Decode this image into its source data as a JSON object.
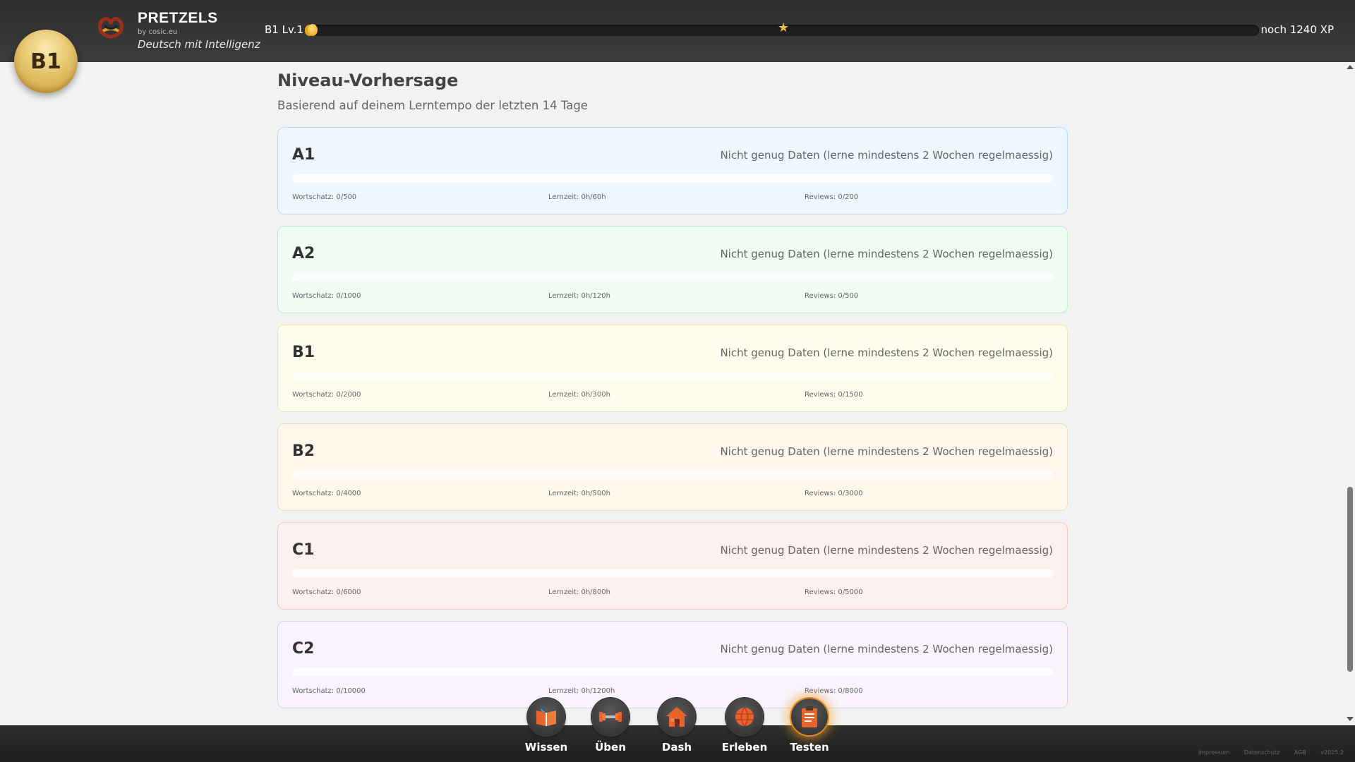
{
  "header": {
    "level_badge": "B1",
    "brand_name": "PRETZELS",
    "brand_by": "by cosic.eu",
    "tagline": "Deutsch mit Intelligenz",
    "level_label": "B1 Lv.1",
    "xp_progress": 0.01,
    "xp_remaining": "noch 1240 XP"
  },
  "main": {
    "title": "Niveau-Vorhersage",
    "subtitle": "Basierend auf deinem Lerntempo der letzten 14 Tage",
    "levels": [
      {
        "level": "A1",
        "message": "Nicht genug Daten (lerne mindestens 2 Wochen regelmaessig)",
        "progress": 0,
        "vocab": "Wortschatz: 0/500",
        "time": "Lernzeit: 0h/60h",
        "reviews": "Reviews: 0/200"
      },
      {
        "level": "A2",
        "message": "Nicht genug Daten (lerne mindestens 2 Wochen regelmaessig)",
        "progress": 0,
        "vocab": "Wortschatz: 0/1000",
        "time": "Lernzeit: 0h/120h",
        "reviews": "Reviews: 0/500"
      },
      {
        "level": "B1",
        "message": "Nicht genug Daten (lerne mindestens 2 Wochen regelmaessig)",
        "progress": 0,
        "vocab": "Wortschatz: 0/2000",
        "time": "Lernzeit: 0h/300h",
        "reviews": "Reviews: 0/1500"
      },
      {
        "level": "B2",
        "message": "Nicht genug Daten (lerne mindestens 2 Wochen regelmaessig)",
        "progress": 0,
        "vocab": "Wortschatz: 0/4000",
        "time": "Lernzeit: 0h/500h",
        "reviews": "Reviews: 0/3000"
      },
      {
        "level": "C1",
        "message": "Nicht genug Daten (lerne mindestens 2 Wochen regelmaessig)",
        "progress": 0,
        "vocab": "Wortschatz: 0/6000",
        "time": "Lernzeit: 0h/800h",
        "reviews": "Reviews: 0/5000"
      },
      {
        "level": "C2",
        "message": "Nicht genug Daten (lerne mindestens 2 Wochen regelmaessig)",
        "progress": 0,
        "vocab": "Wortschatz: 0/10000",
        "time": "Lernzeit: 0h/1200h",
        "reviews": "Reviews: 0/8000"
      }
    ]
  },
  "nav": {
    "items": [
      {
        "label": "Wissen",
        "icon": "book-icon"
      },
      {
        "label": "Üben",
        "icon": "dumbbell-icon"
      },
      {
        "label": "Dash",
        "icon": "house-icon"
      },
      {
        "label": "Erleben",
        "icon": "globe-icon"
      },
      {
        "label": "Testen",
        "icon": "clipboard-icon"
      }
    ],
    "active": "Testen"
  },
  "footer": {
    "links": [
      "Impressum",
      "Datenschutz",
      "AGB",
      "v2025.2"
    ]
  }
}
